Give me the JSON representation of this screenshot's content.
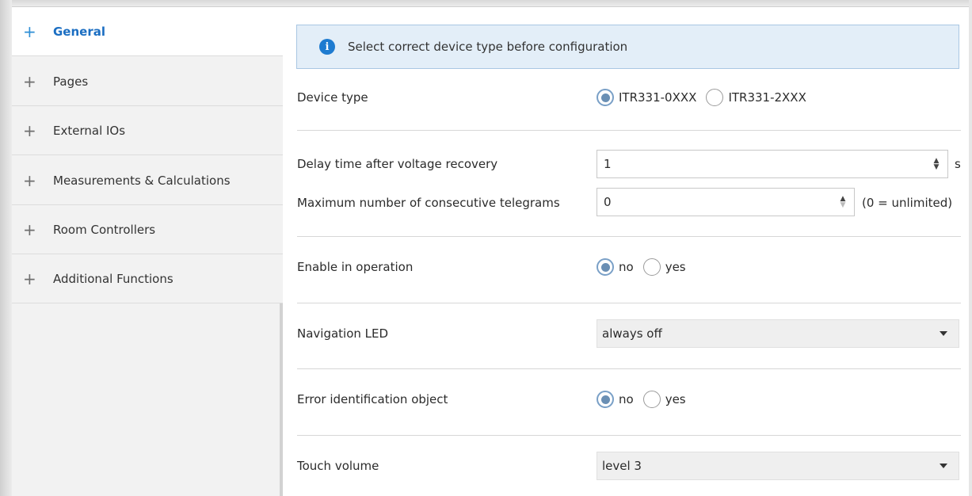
{
  "sidebar": {
    "items": [
      {
        "label": "General",
        "active": true
      },
      {
        "label": "Pages"
      },
      {
        "label": "External IOs"
      },
      {
        "label": "Measurements & Calculations"
      },
      {
        "label": "Room Controllers"
      },
      {
        "label": "Additional Functions"
      }
    ],
    "expand_symbol": "+"
  },
  "info": {
    "icon": "info-icon",
    "icon_glyph": "i",
    "text": "Select correct device type before configuration"
  },
  "device_type": {
    "label": "Device type",
    "options": [
      "ITR331-0XXX",
      "ITR331-2XXX"
    ],
    "selected": "ITR331-0XXX"
  },
  "delay_time": {
    "label": "Delay time after voltage recovery",
    "value": "1",
    "unit": "s"
  },
  "max_telegrams": {
    "label": "Maximum number of consecutive telegrams",
    "value": "0",
    "unit": "(0 = unlimited)"
  },
  "enable_operation": {
    "label": "Enable in operation",
    "options": [
      "no",
      "yes"
    ],
    "selected": "no"
  },
  "navigation_led": {
    "label": "Navigation LED",
    "value": "always off"
  },
  "error_object": {
    "label": "Error identification object",
    "options": [
      "no",
      "yes"
    ],
    "selected": "no"
  },
  "touch_volume": {
    "label": "Touch volume",
    "value": "level 3"
  },
  "colors": {
    "accent": "#1b6ec2",
    "info_bg": "#e3eef8",
    "sidebar_bg": "#f2f2f2"
  }
}
